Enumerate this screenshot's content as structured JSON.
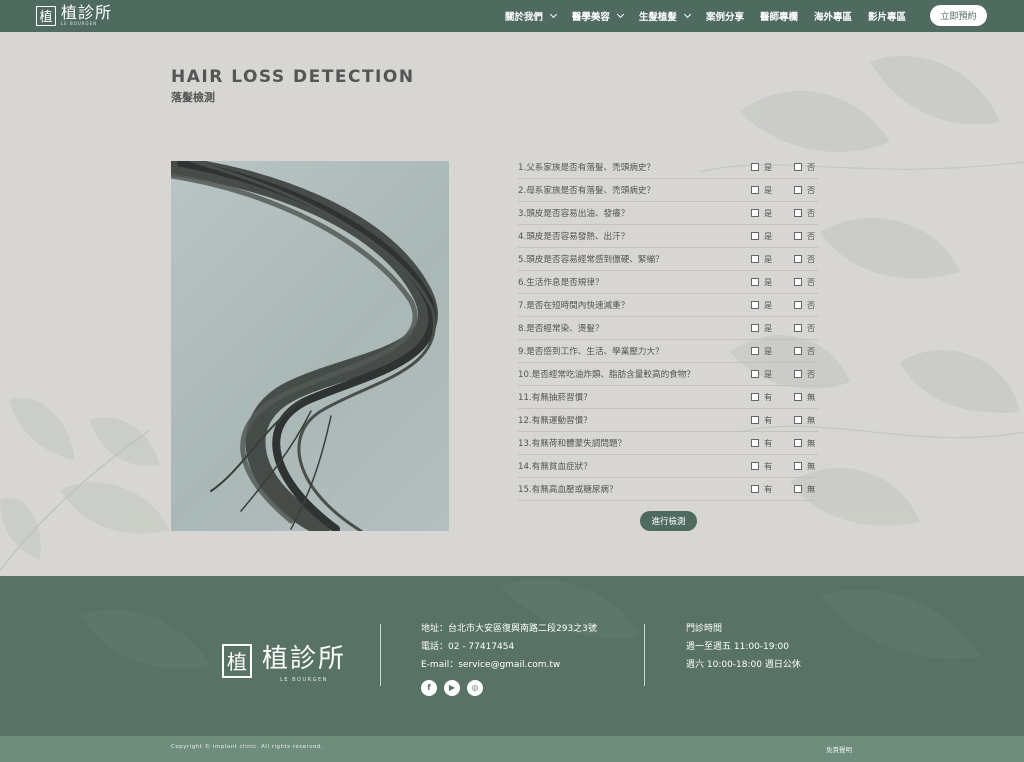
{
  "header": {
    "logo_mark": "植",
    "logo_text": "植診所",
    "logo_sub": "LE BOURGEN",
    "nav": [
      {
        "label": "關於我們",
        "has_dropdown": true
      },
      {
        "label": "醫學美容",
        "has_dropdown": true
      },
      {
        "label": "生髮植髮",
        "has_dropdown": true
      },
      {
        "label": "案例分享",
        "has_dropdown": false
      },
      {
        "label": "醫師專欄",
        "has_dropdown": false
      },
      {
        "label": "海外專區",
        "has_dropdown": false
      },
      {
        "label": "影片專區",
        "has_dropdown": false
      }
    ],
    "book_label": "立即預約"
  },
  "page": {
    "title_en": "HAIR LOSS DETECTION",
    "title_cn": "落髮檢測"
  },
  "quiz": {
    "questions": [
      {
        "text": "1.父系家族是否有落髮、禿頭病史？",
        "opt_a": "是",
        "opt_b": "否"
      },
      {
        "text": "2.母系家族是否有落髮、禿頭病史？",
        "opt_a": "是",
        "opt_b": "否"
      },
      {
        "text": "3.頭皮是否容易出油、發癢？",
        "opt_a": "是",
        "opt_b": "否"
      },
      {
        "text": "4.頭皮是否容易發熱、出汗？",
        "opt_a": "是",
        "opt_b": "否"
      },
      {
        "text": "5.頭皮是否容易經常感到僵硬、緊繃？",
        "opt_a": "是",
        "opt_b": "否"
      },
      {
        "text": "6.生活作息是否規律？",
        "opt_a": "是",
        "opt_b": "否"
      },
      {
        "text": "7.是否在短時間內快速減重？",
        "opt_a": "是",
        "opt_b": "否"
      },
      {
        "text": "8.是否經常染、燙髮？",
        "opt_a": "是",
        "opt_b": "否"
      },
      {
        "text": "9.是否感到工作、生活、學業壓力大？",
        "opt_a": "是",
        "opt_b": "否"
      },
      {
        "text": "10.是否經常吃油炸類、脂肪含量較高的食物？",
        "opt_a": "是",
        "opt_b": "否"
      },
      {
        "text": "11.有無抽菸習慣？",
        "opt_a": "有",
        "opt_b": "無"
      },
      {
        "text": "12.有無運動習慣？",
        "opt_a": "有",
        "opt_b": "無"
      },
      {
        "text": "13.有無荷和體蒙失調問題？",
        "opt_a": "有",
        "opt_b": "無"
      },
      {
        "text": "14.有無貧血症狀？",
        "opt_a": "有",
        "opt_b": "無"
      },
      {
        "text": "15.有無高血壓或糖尿病？",
        "opt_a": "有",
        "opt_b": "無"
      }
    ],
    "submit_label": "進行檢測"
  },
  "footer": {
    "logo_text": "植診所",
    "logo_sub": "LE BOURGEN",
    "address": "地址：台北市大安區復興南路二段293之3號",
    "phone": "電話：02 - 77417454",
    "email": "E-mail：service@gmail.com.tw",
    "hours_title": "門診時間",
    "hours_weekday": "週一至週五 11:00-19:00",
    "hours_sat": "週六 10:00-18:00 週日公休",
    "copyright": "Copyright © implant clinic. All rights reserved.",
    "disclaimer": "免責聲明"
  },
  "colors": {
    "brand_green": "#4f6b60",
    "footer_green": "#587265",
    "bottom_green": "#6f8d7d",
    "page_bg": "#d8d6d3"
  }
}
